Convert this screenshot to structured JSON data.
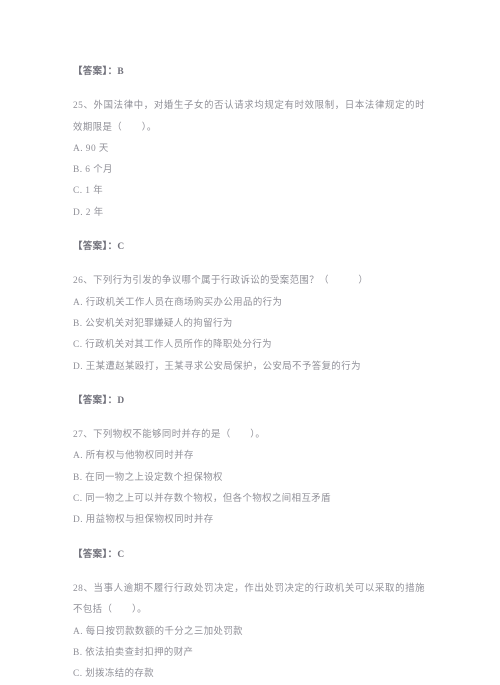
{
  "document": {
    "page_background": "#ffffff",
    "text_color": "#8f8f97",
    "blocks": [
      {
        "type": "answer",
        "text": "【答案】：B"
      },
      {
        "type": "question",
        "number": "25",
        "stem": "25、外国法律中，对婚生子女的否认请求均规定有时效限制，日本法律规定的时效期限是（　　）。",
        "options": [
          "A. 90 天",
          "B. 6 个月",
          "C. 1 年",
          "D. 2 年"
        ]
      },
      {
        "type": "answer",
        "text": "【答案】：C"
      },
      {
        "type": "question",
        "number": "26",
        "stem": "26、下列行为引发的争议哪个属于行政诉讼的受案范围？（　　　）",
        "options": [
          "A. 行政机关工作人员在商场购买办公用品的行为",
          "B. 公安机关对犯罪嫌疑人的拘留行为",
          "C. 行政机关对其工作人员所作的降职处分行为",
          "D. 王某遭赵某殴打，王某寻求公安局保护，公安局不予答复的行为"
        ]
      },
      {
        "type": "answer",
        "text": "【答案】：D"
      },
      {
        "type": "question",
        "number": "27",
        "stem": "27、下列物权不能够同时并存的是（　　）。",
        "options": [
          "A. 所有权与他物权同时并存",
          "B. 在同一物之上设定数个担保物权",
          "C. 同一物之上可以并存数个物权，但各个物权之间相互矛盾",
          "D. 用益物权与担保物权同时并存"
        ]
      },
      {
        "type": "answer",
        "text": "【答案】：C"
      },
      {
        "type": "question",
        "number": "28",
        "stem": "28、当事人逾期不履行行政处罚决定，作出处罚决定的行政机关可以采取的措施不包括（　　）。",
        "options": [
          "A. 每日按罚款数额的千分之三加处罚款",
          "B. 依法拍卖查封扣押的财产",
          "C. 划拨冻结的存款"
        ]
      }
    ]
  }
}
